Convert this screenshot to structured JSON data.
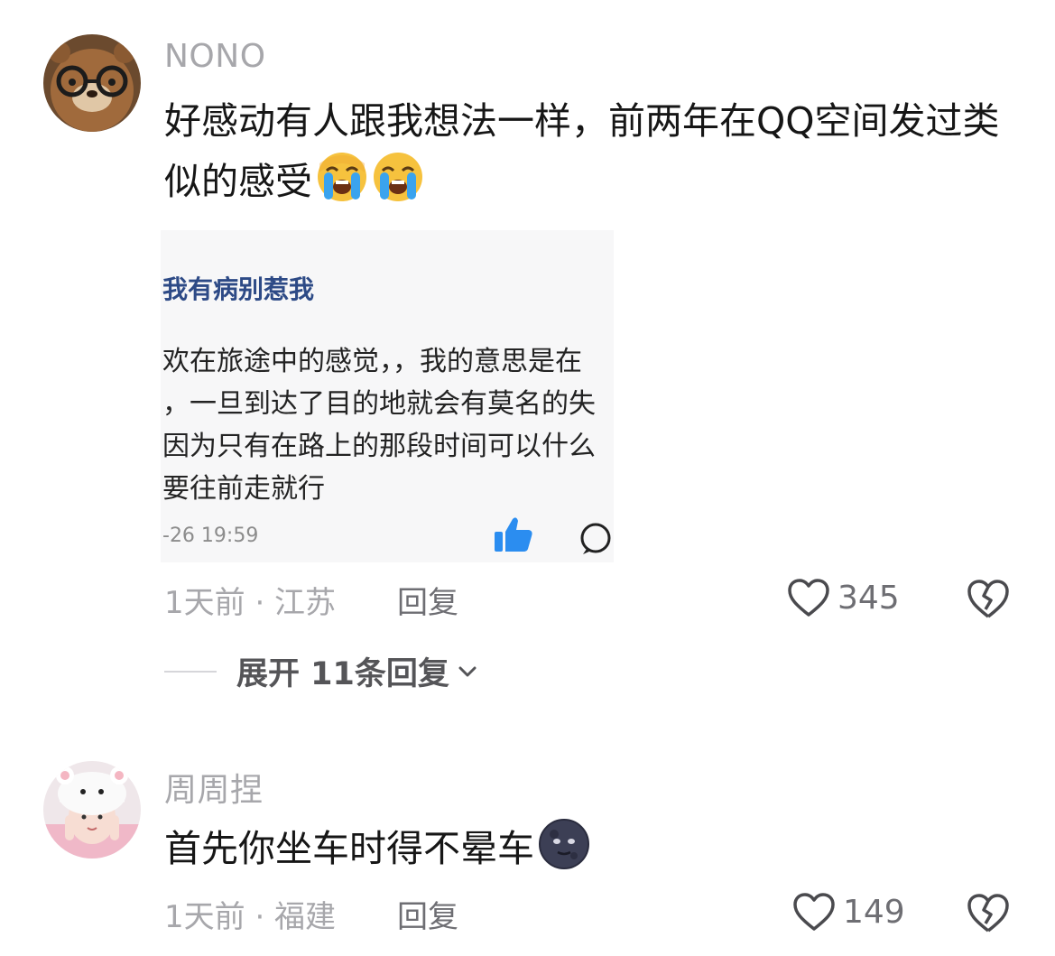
{
  "comments": [
    {
      "username": "NONO",
      "text": "好感动有人跟我想法一样，前两年在QQ空间发过类似的感受",
      "emoji_icons": [
        "loudly-crying-face-icon",
        "loudly-crying-face-icon"
      ],
      "quoted_image": {
        "title": "我有病别惹我",
        "lines": [
          "欢在旅途中的感觉，，我的意思是在",
          "，一旦到达了目的地就会有莫名的失",
          "因为只有在路上的那段时间可以什么",
          "要往前走就行"
        ],
        "time": "-26 19:59"
      },
      "time_location": "1天前 · 江苏",
      "reply_label": "回复",
      "like_count": "345",
      "expand_label": "展开 11条回复"
    },
    {
      "username": "周周捏",
      "text": "首先你坐车时得不晕车",
      "emoji_icons": [
        "new-moon-face-icon"
      ],
      "time_location": "1天前 · 福建",
      "reply_label": "回复",
      "like_count": "149"
    }
  ],
  "colors": {
    "username": "#a7a7ab",
    "text": "#161616",
    "quote_title": "#2d4a86",
    "thumb_blue": "#2b8df0"
  }
}
